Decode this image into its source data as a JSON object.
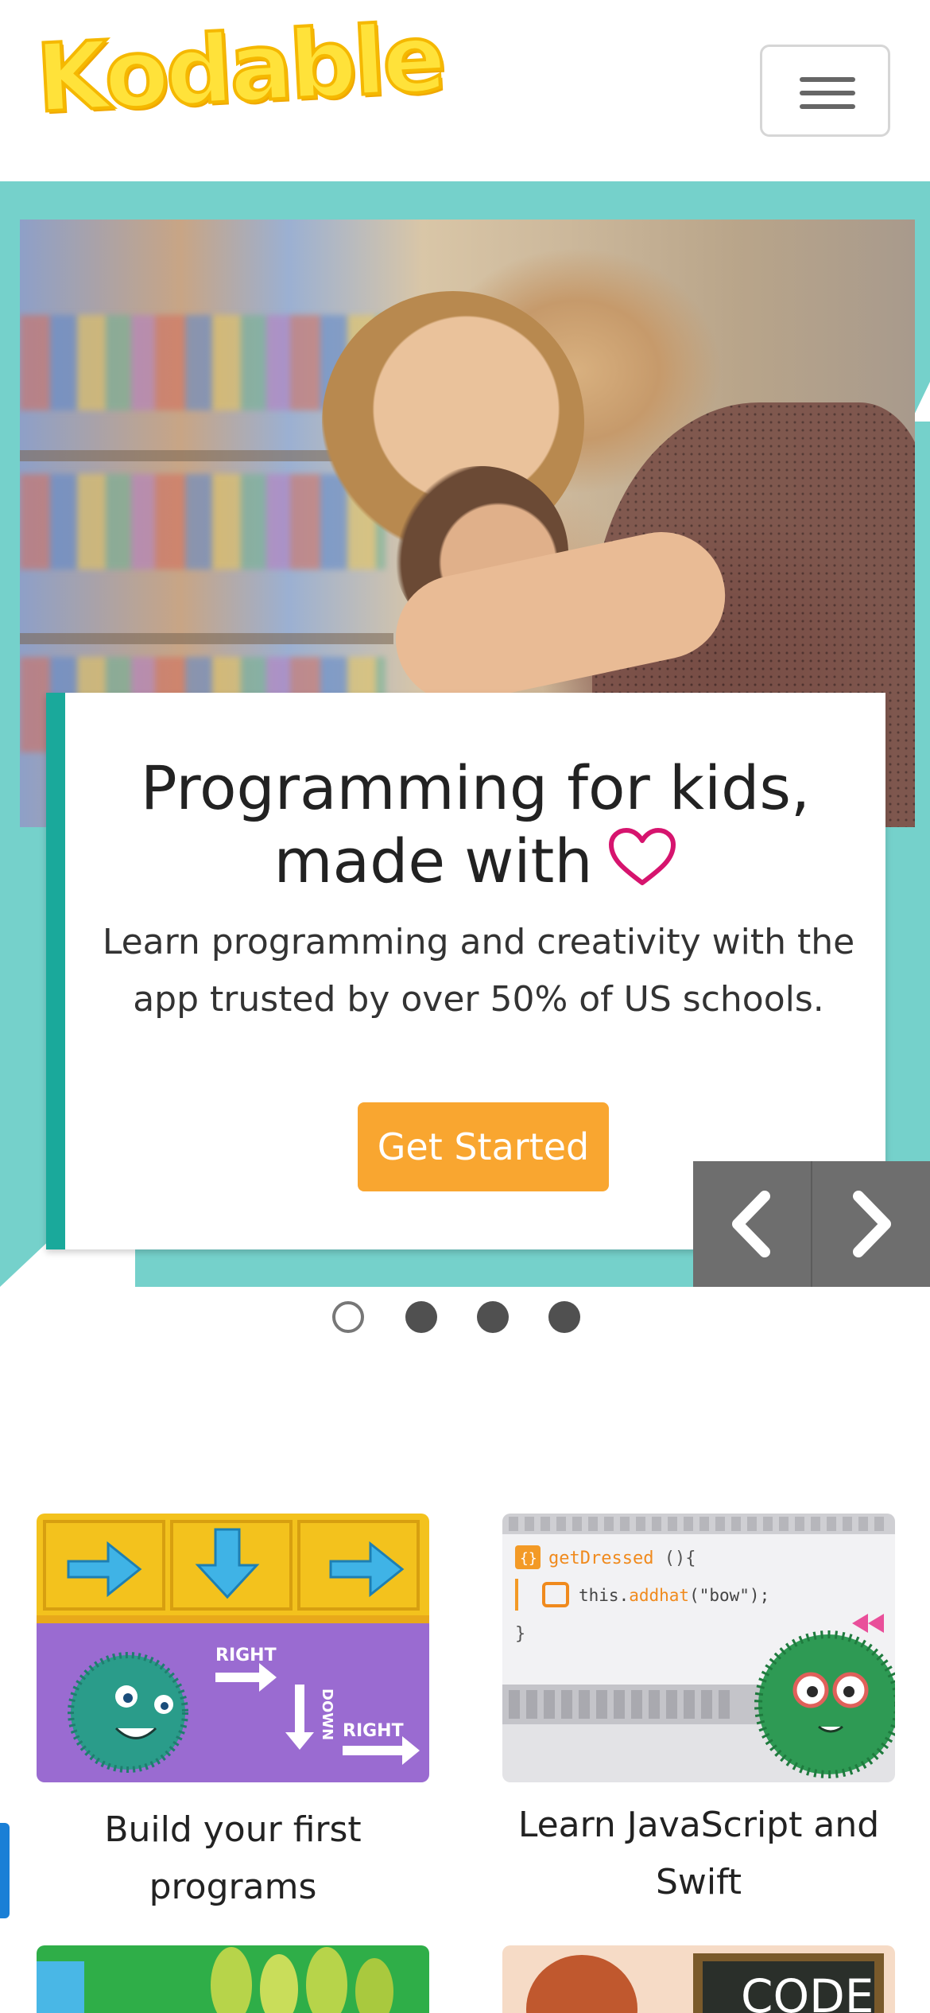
{
  "header": {
    "logo_text": "Kodable",
    "menu_icon": "hamburger-menu-icon"
  },
  "hero": {
    "title_line1": "Programming for kids,",
    "title_line2": "made with",
    "heart_icon": "heart-outline-icon",
    "subtitle": "Learn programming and creativity with the app trusted by over 50% of US schools.",
    "cta_label": "Get Started",
    "prev_icon": "chevron-left-icon",
    "next_icon": "chevron-right-icon",
    "slides_count": 4,
    "active_slide": 1
  },
  "features": [
    {
      "label": "Build your first programs"
    },
    {
      "label": "Learn JavaScript and Swift"
    }
  ],
  "tile2_code": {
    "line1_fn": "getDressed",
    "line1_rest": " (){",
    "line2_this": "this.",
    "line2_method": "addhat",
    "line2_arg": "(\"bow\");",
    "line3": "}"
  },
  "tile1_words": {
    "right1": "RIGHT",
    "down": "DOWN",
    "right2": "RIGHT"
  },
  "tile4_board_text": "CODE",
  "colors": {
    "teal": "#75d1cb",
    "teal_dark": "#1aa99b",
    "cta": "#f9a630",
    "heart": "#d6146e",
    "logo_yellow": "#ffe23a"
  }
}
